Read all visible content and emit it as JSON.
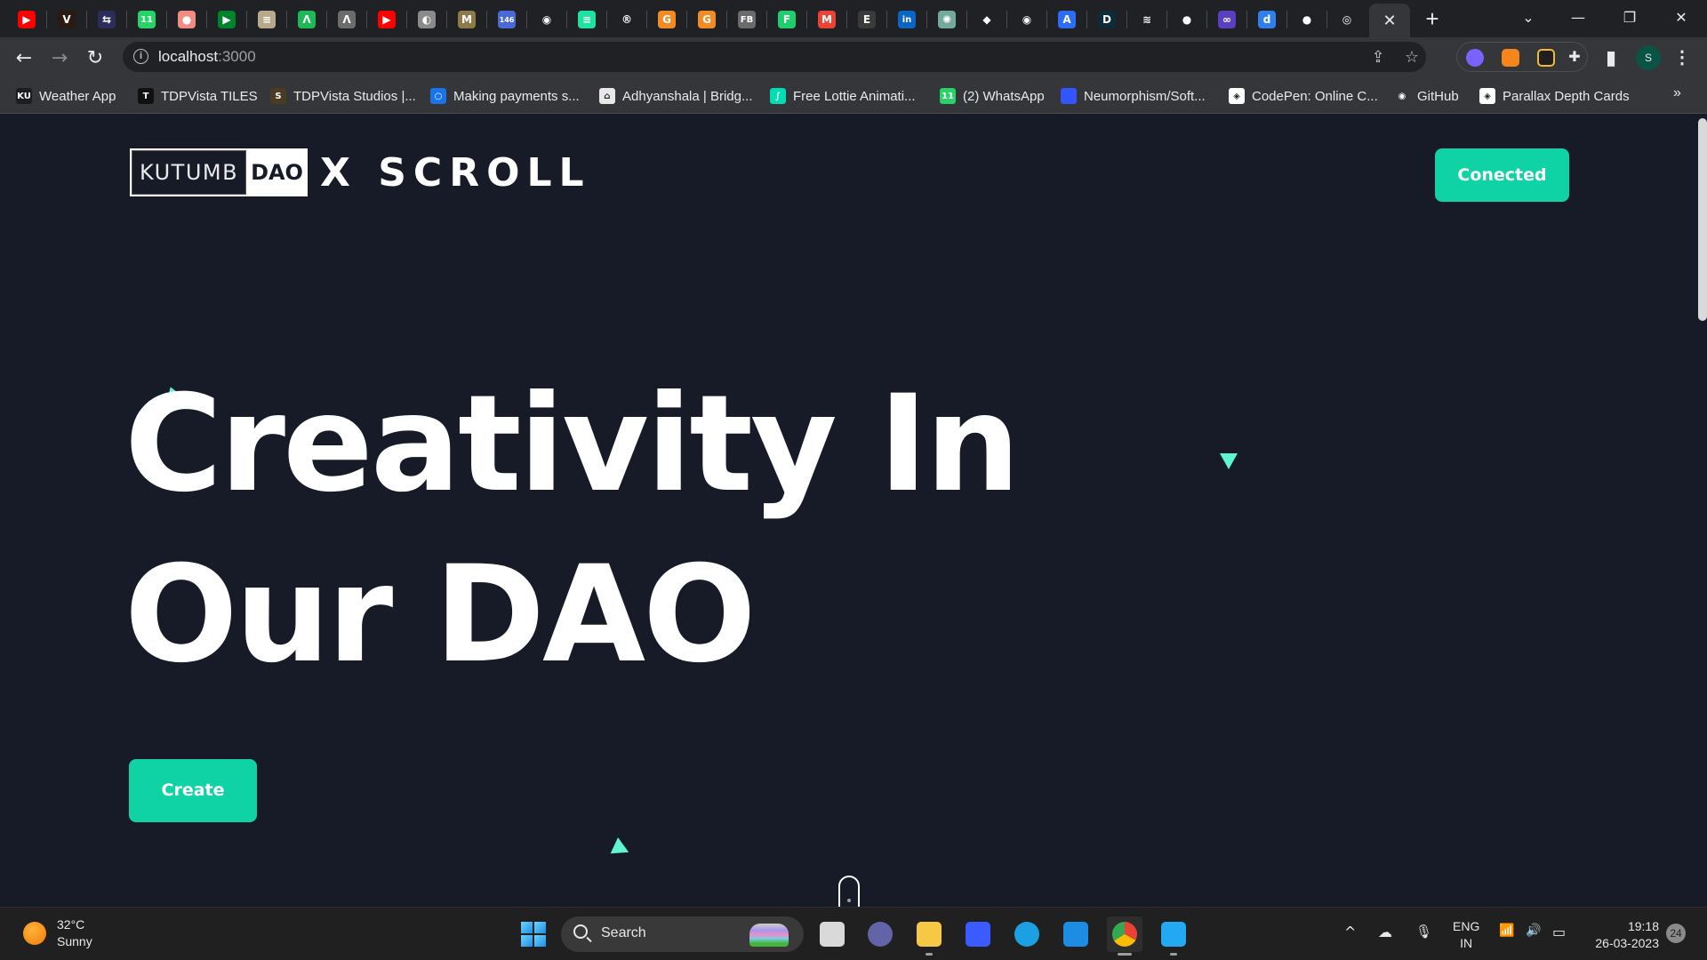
{
  "browser": {
    "tabs": [
      {
        "icon": "youtube-icon",
        "color": "#ff0000",
        "glyph": "▶"
      },
      {
        "icon": "v-brand-icon",
        "color": "#2a1a12",
        "glyph": "V"
      },
      {
        "icon": "arrows-swap-icon",
        "color": "#2b2d5a",
        "glyph": "⇆"
      },
      {
        "icon": "whatsapp-icon",
        "color": "#25d366",
        "glyph": "11"
      },
      {
        "icon": "record-icon",
        "color": "#f28b82",
        "glyph": "●"
      },
      {
        "icon": "google-meet-icon",
        "color": "#00832d",
        "glyph": "▶"
      },
      {
        "icon": "scroll-paper-icon",
        "color": "#b8a98a",
        "glyph": "≡"
      },
      {
        "icon": "green-a-icon",
        "color": "#1db954",
        "glyph": "Λ"
      },
      {
        "icon": "gray-a-icon",
        "color": "#6c6c6c",
        "glyph": "Λ"
      },
      {
        "icon": "youtube-icon",
        "color": "#ff0000",
        "glyph": "▶"
      },
      {
        "icon": "globe-icon",
        "color": "#8a8a8a",
        "glyph": "◐"
      },
      {
        "icon": "m-brand-icon",
        "color": "#8d7a4a",
        "glyph": "M"
      },
      {
        "icon": "notification-badge-icon",
        "color": "#4a68d6",
        "glyph": "146"
      },
      {
        "icon": "github-icon",
        "color": "#202124",
        "glyph": "◉"
      },
      {
        "icon": "list-app-icon",
        "color": "#1ee3a0",
        "glyph": "≡"
      },
      {
        "icon": "r-circle-icon",
        "color": "#202124",
        "glyph": "®"
      },
      {
        "icon": "g-orange-icon",
        "color": "#f28b24",
        "glyph": "G"
      },
      {
        "icon": "g-orange-icon",
        "color": "#f28b24",
        "glyph": "G"
      },
      {
        "icon": "fb-book-icon",
        "color": "#6b6b6b",
        "glyph": "FB"
      },
      {
        "icon": "f-green-icon",
        "color": "#1fce6d",
        "glyph": "F"
      },
      {
        "icon": "gmail-icon",
        "color": "#ea4335",
        "glyph": "M"
      },
      {
        "icon": "e-cell-icon",
        "color": "#3a3a3a",
        "glyph": "E"
      },
      {
        "icon": "linkedin-icon",
        "color": "#0a66c2",
        "glyph": "in"
      },
      {
        "icon": "chatgpt-icon",
        "color": "#74aa9c",
        "glyph": "✺"
      },
      {
        "icon": "binance-icon",
        "color": "#202124",
        "glyph": "◆"
      },
      {
        "icon": "github-icon",
        "color": "#202124",
        "glyph": "◉"
      },
      {
        "icon": "a-blue-icon",
        "color": "#2f6cf6",
        "glyph": "A"
      },
      {
        "icon": "d-hex-icon",
        "color": "#0e2b3a",
        "glyph": "D"
      },
      {
        "icon": "stackoverflow-icon",
        "color": "#202124",
        "glyph": "≋"
      },
      {
        "icon": "android-icon",
        "color": "#202124",
        "glyph": "●"
      },
      {
        "icon": "binoculars-icon",
        "color": "#5a3fc0",
        "glyph": "∞"
      },
      {
        "icon": "d-blue-icon",
        "color": "#2f80ed",
        "glyph": "d"
      },
      {
        "icon": "android-icon",
        "color": "#202124",
        "glyph": "●"
      },
      {
        "icon": "chrome-icon",
        "color": "#202124",
        "glyph": "◎"
      }
    ],
    "active_tab_close": "✕",
    "new_tab": "+",
    "window_controls": {
      "tab_search": "⌄",
      "minimize": "—",
      "restore": "❐",
      "close": "✕"
    },
    "nav": {
      "back": "←",
      "forward": "→",
      "reload": "↻"
    },
    "address": {
      "host": "localhost",
      "port": ":3000",
      "info_glyph": "i"
    },
    "omnibox_icons": {
      "share": "⇪",
      "bookmark": "☆"
    },
    "extensions": [
      {
        "name": "phantom-extension-icon",
        "color": "#7b61ff"
      },
      {
        "name": "metamask-extension-icon",
        "color": "#f6851b"
      },
      {
        "name": "bnb-extension-icon",
        "color": "#f3ba2f"
      },
      {
        "name": "puzzle-extensions-icon",
        "color": "#e8eaed"
      }
    ],
    "side_panel_glyph": "▮",
    "profile_initial": "S",
    "menu_glyph": "⋮",
    "bookmarks": [
      {
        "label": "Weather App",
        "icon": "ku-icon",
        "color": "#1b1d22",
        "glyph": "KU"
      },
      {
        "label": "TDPVista TILES",
        "icon": "tdpvista-tiles-icon",
        "color": "#111111",
        "glyph": "T"
      },
      {
        "label": "TDPVista Studios |...",
        "icon": "tdpvista-studios-icon",
        "color": "#4a3b22",
        "glyph": "S"
      },
      {
        "label": "Making payments s...",
        "icon": "payments-ring-icon",
        "color": "#1a73e8",
        "glyph": "○"
      },
      {
        "label": "Adhyanshala | Bridg...",
        "icon": "building-icon",
        "color": "#e8e8e8",
        "glyph": "⌂"
      },
      {
        "label": "Free Lottie Animati...",
        "icon": "lottie-icon",
        "color": "#00ddb3",
        "glyph": "∫"
      },
      {
        "label": "(2) WhatsApp",
        "icon": "whatsapp-icon",
        "color": "#25d366",
        "glyph": "11"
      },
      {
        "label": "Neumorphism/Soft...",
        "icon": "neumorphism-icon",
        "color": "#3355ff",
        "glyph": ""
      },
      {
        "label": "CodePen: Online C...",
        "icon": "codepen-icon",
        "color": "#ffffff",
        "glyph": "◈"
      },
      {
        "label": "GitHub",
        "icon": "github-icon",
        "color": "#35363a",
        "glyph": "◉"
      },
      {
        "label": "Parallax Depth Cards",
        "icon": "codepen-icon",
        "color": "#ffffff",
        "glyph": "◈"
      }
    ],
    "bookmarks_more": "»"
  },
  "page": {
    "logo": {
      "left": "KUTUMB",
      "right": "DAO",
      "suffix": "X SCROLL"
    },
    "connect_button": "Conected",
    "hero": {
      "line1": "Creativity In",
      "line2": "Our DAO"
    },
    "create_button": "Create",
    "colors": {
      "background": "#161b27",
      "accent": "#10d3a5",
      "decor": "#5ff5d3"
    }
  },
  "taskbar": {
    "weather": {
      "temp": "32°C",
      "condition": "Sunny"
    },
    "search_label": "Search",
    "apps": [
      {
        "name": "task-view-icon",
        "color": "#d9d9d9"
      },
      {
        "name": "teams-chat-icon",
        "color": "#6264a7"
      },
      {
        "name": "file-explorer-icon",
        "color": "#f7c844"
      },
      {
        "name": "ms-app-icon",
        "color": "#3b5bff"
      },
      {
        "name": "edge-icon",
        "color": "#1ba1e2"
      },
      {
        "name": "mail-icon",
        "color": "#1c8de3"
      },
      {
        "name": "chrome-icon",
        "color": "#ea4335"
      },
      {
        "name": "vscode-icon",
        "color": "#23a9f2"
      }
    ],
    "tray": {
      "chevron": "^",
      "cloud": "☁",
      "mic": "🎙",
      "wifi": "📶",
      "volume": "🔊",
      "battery": "▭"
    },
    "language": {
      "line1": "ENG",
      "line2": "IN"
    },
    "clock": {
      "time": "19:18",
      "date": "26-03-2023"
    },
    "notifications": "24"
  }
}
